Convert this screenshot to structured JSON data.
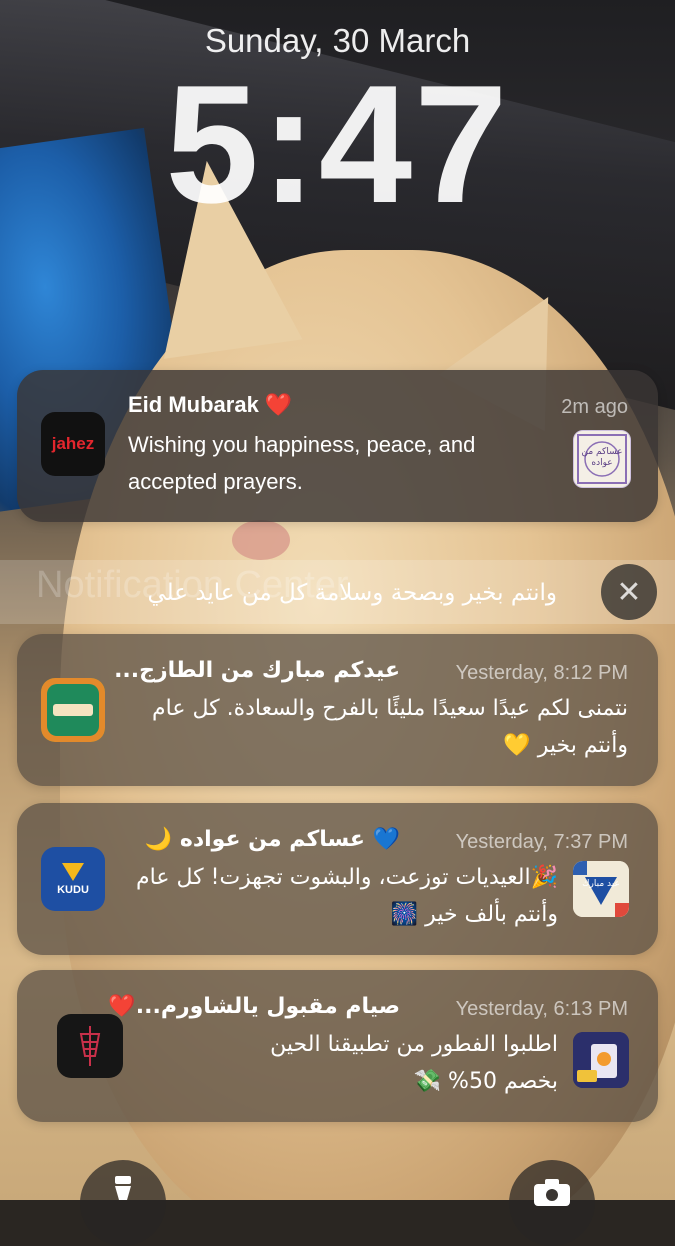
{
  "lockscreen": {
    "date": "Sunday, 30 March",
    "time": "5:47"
  },
  "notifications": [
    {
      "app": "Jahez",
      "app_icon_text": "jahez",
      "title": "Eid Mubarak ❤️",
      "time": "2m ago",
      "body": "Wishing you happiness, peace, and accepted prayers.",
      "thumb_text": "عساكم من عواده"
    },
    {
      "app": "Altazaj",
      "title": "عيدكم مبارك من الطازج...",
      "time": "Yesterday, 8:12 PM",
      "body": "نتمنى لكم عيدًا سعيدًا مليئًا بالفرح والسعادة. كل عام وأنتم بخير 💛"
    },
    {
      "app": "Kudu",
      "app_icon_text": "KUDU",
      "title": "💙 عساكم من عواده 🌙",
      "time": "Yesterday, 7:37 PM",
      "body": "🎉العيديات توزعت، والبشوت تجهزت! كل عام وأنتم بألف خير 🎆",
      "thumb_text": "عيد مبارك"
    },
    {
      "app": "Shawarma",
      "title": "صيام مقبول يالشاورم...❤️",
      "time": "Yesterday, 6:13 PM",
      "body": "اطلبوا الفطور من تطبيقنا الحين بخصم 50% 💸"
    }
  ],
  "notification_center": {
    "label": "Notification Center",
    "text": "وانتم بخير وبصحة وسلامة كل من عايد علي",
    "close_symbol": "✕"
  },
  "colors": {
    "jahez_red": "#e3262d",
    "kudu_blue": "#1e4fa3",
    "altazaj_green": "#1f8a5b"
  },
  "icons": [
    "flashlight-icon",
    "camera-icon",
    "close-icon"
  ]
}
